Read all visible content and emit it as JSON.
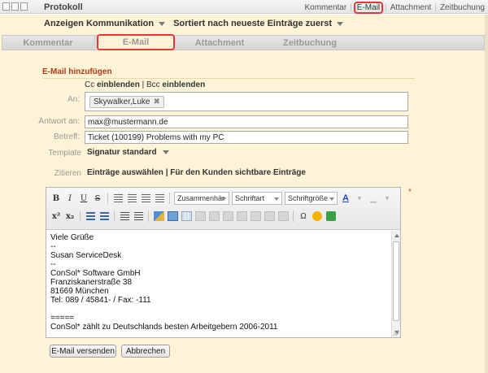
{
  "header": {
    "title": "Protokoll",
    "nav": [
      "Kommentar",
      "E-Mail",
      "Attachment",
      "Zeitbuchung"
    ],
    "active_nav": "E-Mail"
  },
  "filters": {
    "type": "Anzeigen Kommunikation",
    "sort": "Sortiert nach neueste Einträge zuerst"
  },
  "tabs": [
    {
      "label": "Kommentar"
    },
    {
      "label": "E-Mail"
    },
    {
      "label": "Attachment"
    },
    {
      "label": "Zeitbuchung"
    }
  ],
  "form": {
    "section_title": "E-Mail hinzufügen",
    "cc_show": "Cc",
    "cc_show_bold": "einblenden",
    "cc_sep": " | ",
    "bcc_show": "Bcc",
    "bcc_show_bold": "einblenden",
    "to_label": "An:",
    "to_recipient": "Skywalker,Luke",
    "reply_label": "Antwort an:",
    "reply_value": "max@mustermann.de",
    "subject_label": "Betreff:",
    "subject_value": "Ticket (100199) Problems with my PC",
    "template_label": "Template",
    "template_value": "Signatur standard",
    "quote_label": "Zitieren",
    "quote_value": "Einträge auswählen | Für den Kunden sichtbare Einträge",
    "required_mark": "*"
  },
  "editor": {
    "toolbar": {
      "bold": "B",
      "italic": "I",
      "underline": "U",
      "strike": "S",
      "format_select": "Zusammenhär",
      "font_select": "Schriftart",
      "size_select": "Schriftgröße",
      "font_color": "A",
      "superscript": "x²",
      "subscript": "x₂",
      "special_char": "Ω"
    },
    "lines": [
      "Viele Grüße",
      "--",
      "Susan ServiceDesk",
      "--",
      "ConSol* Software GmbH",
      "Franziskanerstraße 38",
      "81669 München",
      "Tel: 089 / 45841- / Fax: -111",
      "",
      "=====",
      "ConSol* zählt zu Deutschlands besten Arbeitgebern 2006-2011"
    ]
  },
  "actions": {
    "send": "E-Mail versenden",
    "cancel": "Abbrechen"
  }
}
